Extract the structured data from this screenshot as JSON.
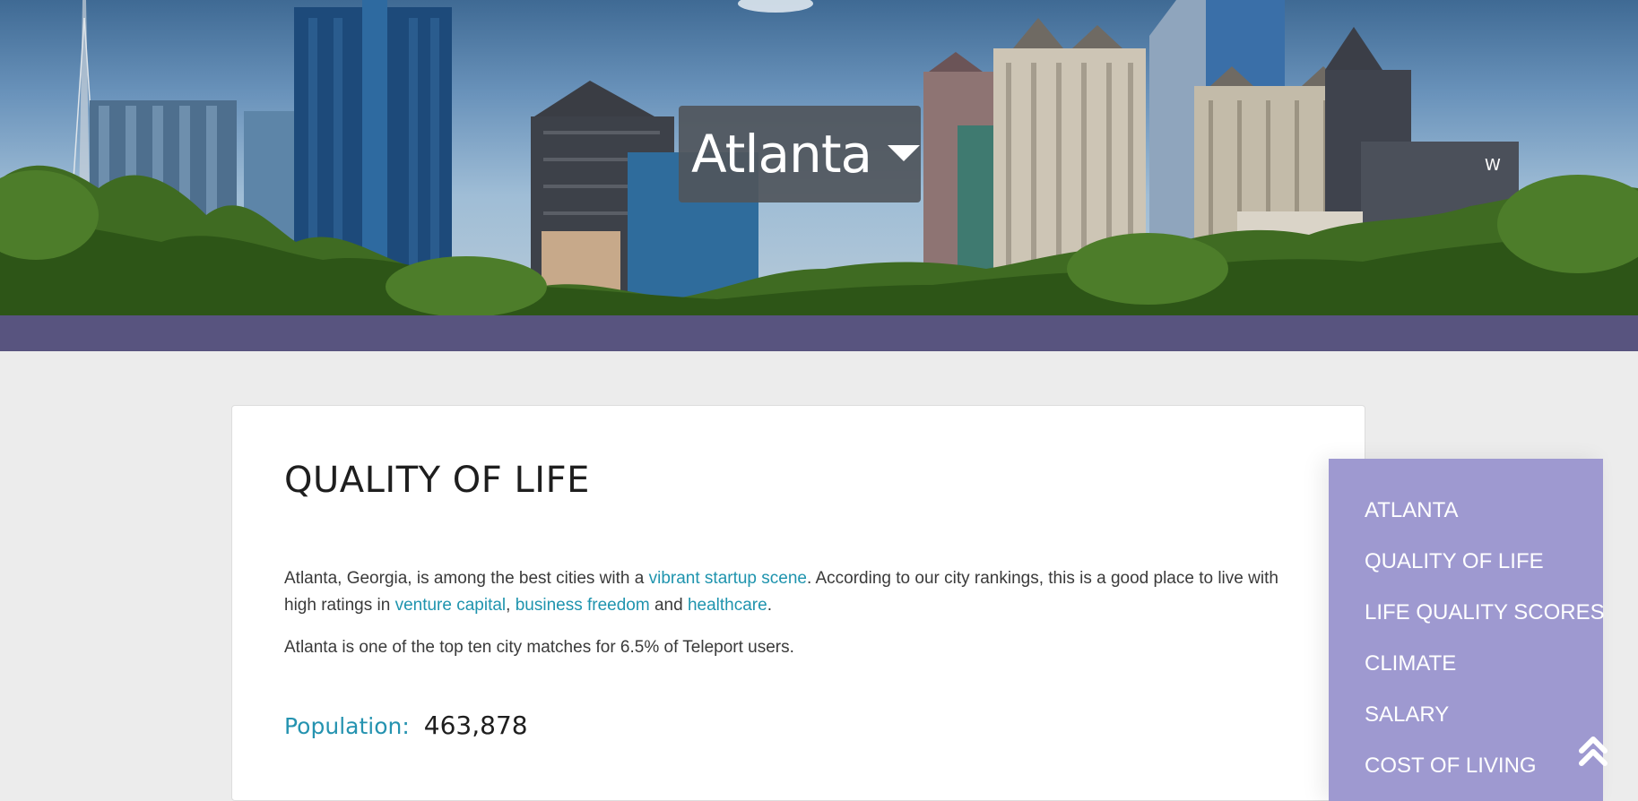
{
  "header": {
    "city": "Atlanta"
  },
  "main": {
    "title": "QUALITY OF LIFE",
    "intro": {
      "text_1": "Atlanta, Georgia, is among the best cities with a ",
      "link_startup": "vibrant startup scene",
      "text_2": ". According to our city rankings, this is a good place to live with high ratings in ",
      "link_venture": "venture capital",
      "text_3": ", ",
      "link_business": "business freedom",
      "text_4": " and ",
      "link_healthcare": "healthcare",
      "text_5": "."
    },
    "matches_text": "Atlanta is one of the top ten city matches for 6.5% of Teleport users.",
    "population_label": "Population:",
    "population_value": "463,878"
  },
  "side_nav": {
    "items": [
      {
        "label": "ATLANTA"
      },
      {
        "label": "QUALITY OF LIFE"
      },
      {
        "label": "LIFE QUALITY SCORES"
      },
      {
        "label": "CLIMATE"
      },
      {
        "label": "SALARY"
      },
      {
        "label": "COST OF LIVING"
      }
    ],
    "scroll_top_icon": "double-chevron-up-icon"
  },
  "colors": {
    "band": "#58547f",
    "side_nav_bg": "#9e99d0",
    "link": "#1f94ae",
    "population_label": "#2593b0"
  }
}
